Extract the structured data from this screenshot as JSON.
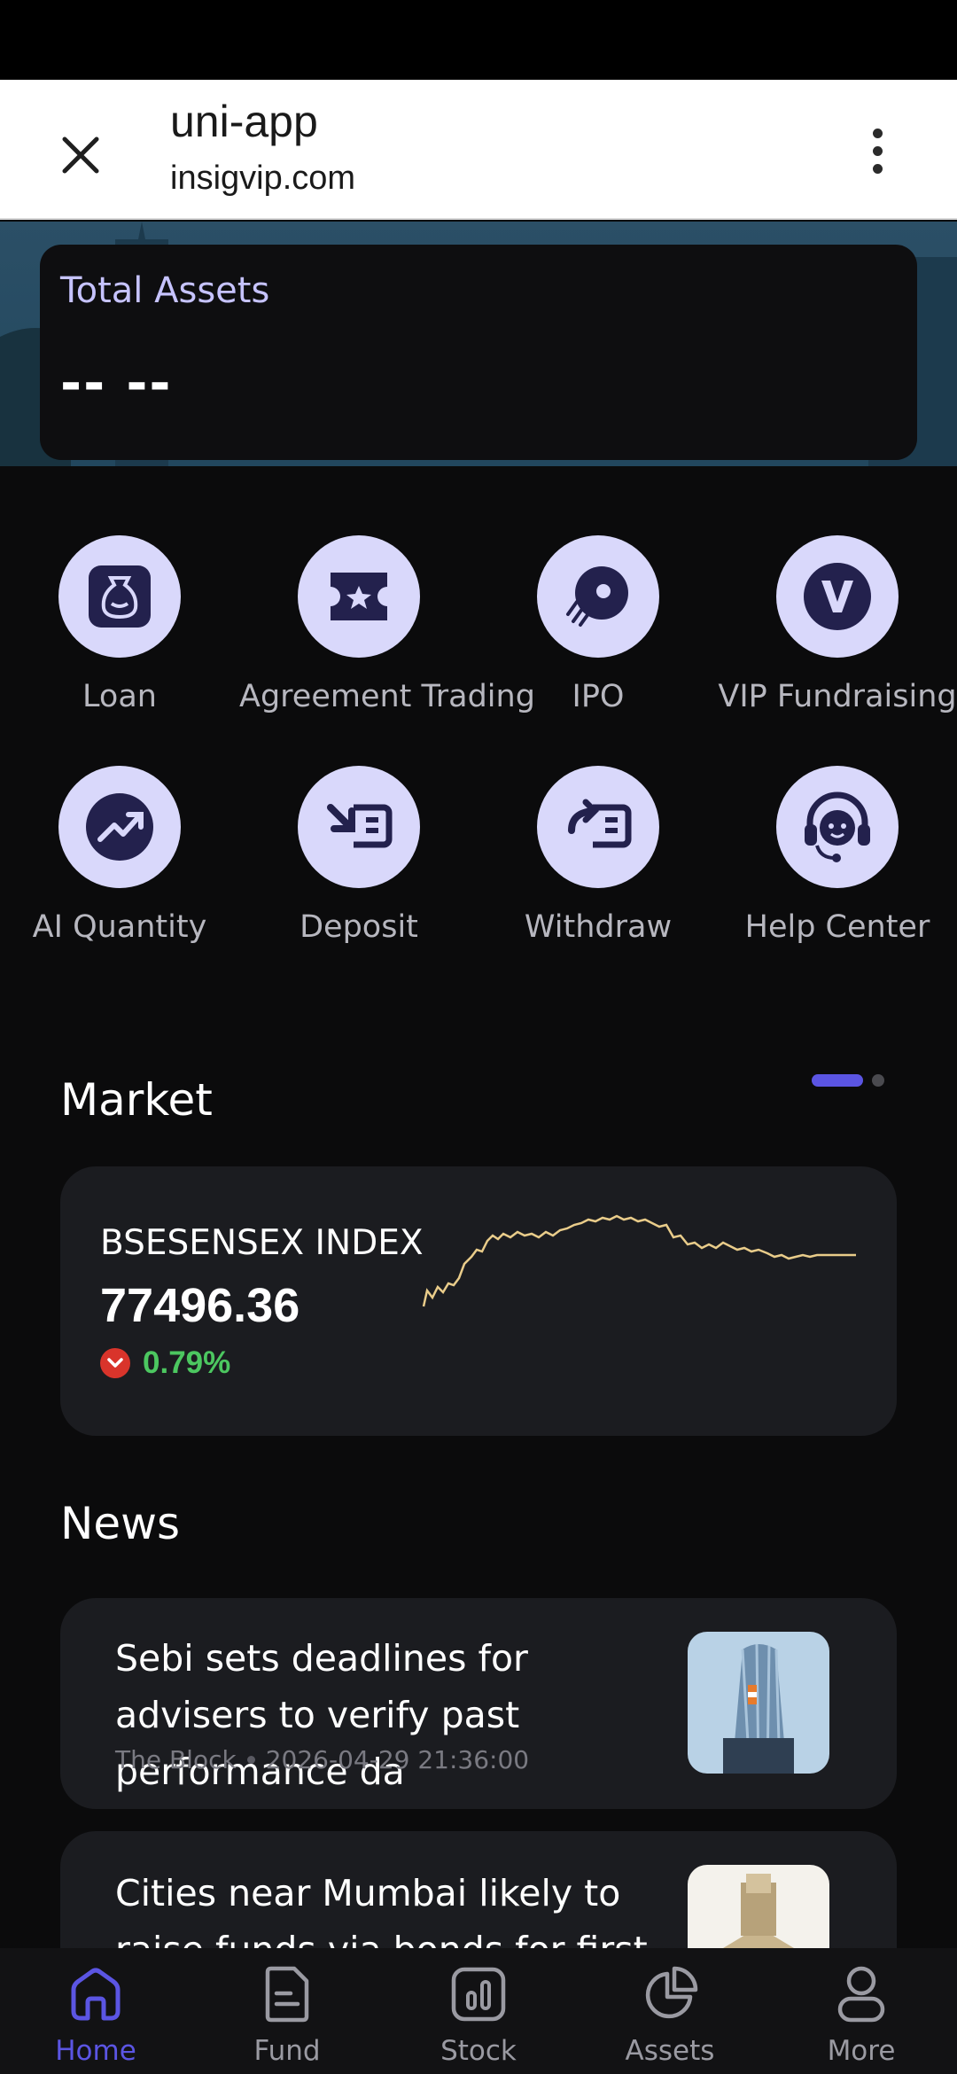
{
  "browser": {
    "title": "uni-app",
    "url": "insigvip.com",
    "close_icon": "close-icon",
    "menu_icon": "more-vertical-icon"
  },
  "assets": {
    "label": "Total Assets",
    "value": "-- --"
  },
  "quick_actions": [
    {
      "label": "Loan",
      "icon": "loan-bag-icon"
    },
    {
      "label": "Agreement Trading",
      "icon": "ticket-star-icon"
    },
    {
      "label": "IPO",
      "icon": "rocket-icon"
    },
    {
      "label": "VIP Fundraising",
      "icon": "vip-v-icon"
    },
    {
      "label": "AI Quantity",
      "icon": "trend-up-icon"
    },
    {
      "label": "Deposit",
      "icon": "deposit-icon"
    },
    {
      "label": "Withdraw",
      "icon": "withdraw-icon"
    },
    {
      "label": "Help Center",
      "icon": "headset-icon"
    }
  ],
  "market": {
    "title": "Market",
    "index_name": "BSESENSEX INDEX",
    "index_value": "77496.36",
    "change": "0.79%",
    "direction": "down",
    "line_color": "#e9cc8a"
  },
  "news": {
    "title": "News",
    "items": [
      {
        "headline": "Sebi sets deadlines for advisers to verify past performance da",
        "source": "The Block",
        "time": "2026-04-29 21:36:00"
      },
      {
        "headline": "Cities near Mumbai likely to raise funds via bonds for first ti",
        "source": "",
        "time": ""
      }
    ]
  },
  "tabs": [
    {
      "label": "Home",
      "icon": "home-icon",
      "active": true
    },
    {
      "label": "Fund",
      "icon": "document-icon",
      "active": false
    },
    {
      "label": "Stock",
      "icon": "bar-chart-icon",
      "active": false
    },
    {
      "label": "Assets",
      "icon": "pie-chart-icon",
      "active": false
    },
    {
      "label": "More",
      "icon": "user-icon",
      "active": false
    }
  ],
  "colors": {
    "accent": "#5b55e3",
    "icon_bg": "#d9d8fb",
    "icon_fg": "#23214d",
    "positive": "#4cc760",
    "down_badge": "#d9342b"
  }
}
